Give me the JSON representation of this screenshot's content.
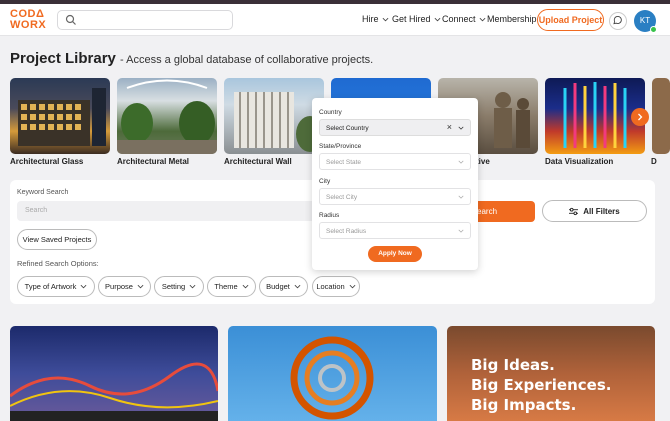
{
  "header": {
    "logo_line1": "CODΔ",
    "logo_line2": "WORX",
    "search_placeholder": "",
    "nav": [
      {
        "label": "Hire",
        "has_dropdown": true
      },
      {
        "label": "Get Hired",
        "has_dropdown": true
      },
      {
        "label": "Connect",
        "has_dropdown": true
      },
      {
        "label": "Membership",
        "has_dropdown": false
      }
    ],
    "upload_label": "Upload Project",
    "avatar_initials": "KT"
  },
  "page": {
    "title": "Project Library",
    "subtitle": "- Access a global database of collaborative projects."
  },
  "carousel": {
    "items": [
      {
        "label": "Architectural Glass"
      },
      {
        "label": "Architectural Metal"
      },
      {
        "label": "Architectural Wall"
      },
      {
        "label": ""
      },
      {
        "label": "tive"
      },
      {
        "label": "Data Visualization"
      },
      {
        "label": "D"
      }
    ]
  },
  "filters": {
    "keyword_label": "Keyword Search",
    "keyword_placeholder": "Search",
    "search_label": "earch",
    "all_filters_label": "All Filters",
    "view_saved_label": "View Saved Projects",
    "refined_label": "Refined Search Options:",
    "pills": [
      "Type of Artwork",
      "Purpose",
      "Setting",
      "Theme",
      "Budget",
      "Location"
    ]
  },
  "location_dropdown": {
    "country_label": "Country",
    "country_value": "Select Country",
    "state_label": "State/Province",
    "state_value": "Select State",
    "city_label": "City",
    "city_value": "Select City",
    "radius_label": "Radius",
    "radius_value": "Select Radius",
    "apply_label": "Apply Now"
  },
  "cards": {
    "promo_lines": [
      "Big Ideas.",
      "Big Experiences.",
      "Big Impacts."
    ]
  },
  "colors": {
    "accent": "#f06a20",
    "avatar": "#2a7fc3"
  }
}
